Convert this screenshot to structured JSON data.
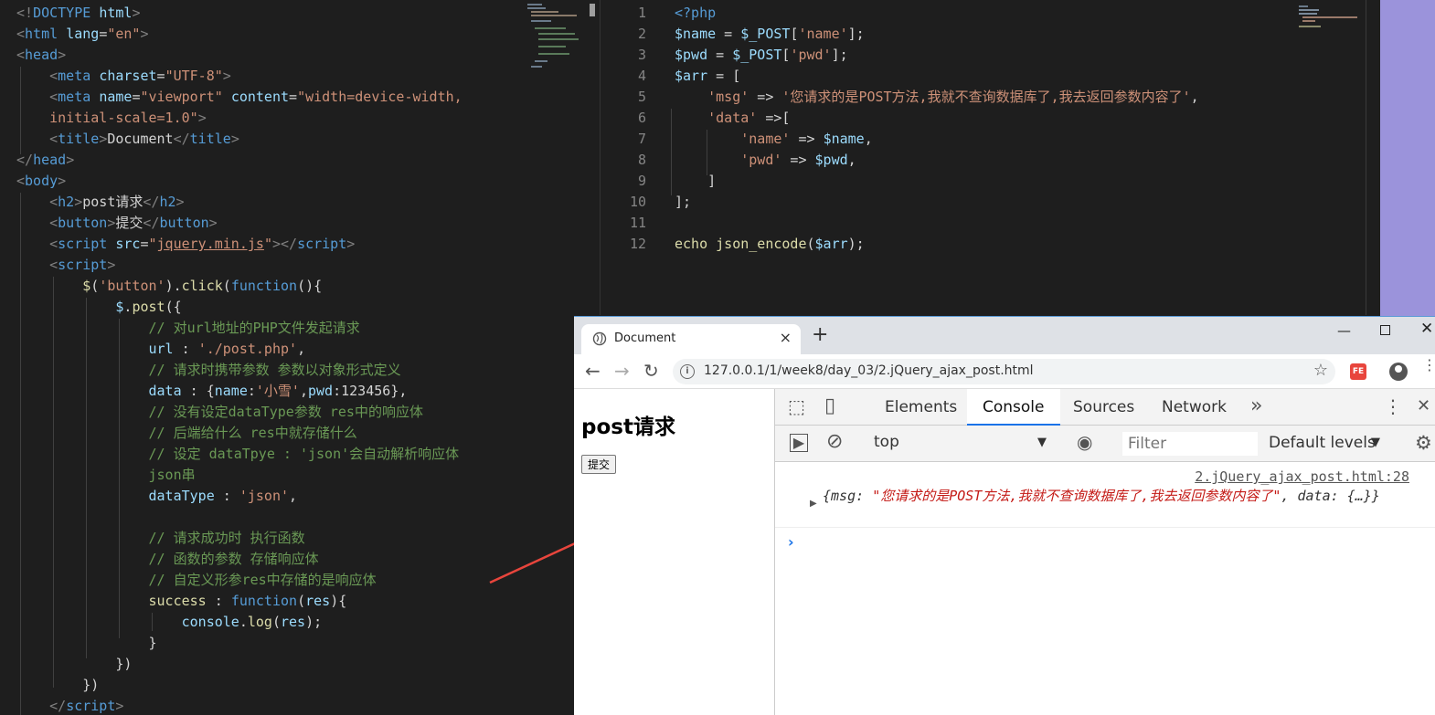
{
  "left_editor": {
    "lines": [
      [
        [
          "tg",
          "<!"
        ],
        [
          "tn",
          "DOCTYPE"
        ],
        [
          "pl",
          " "
        ],
        [
          "at",
          "html"
        ],
        [
          "tg",
          ">"
        ]
      ],
      [
        [
          "tg",
          "<"
        ],
        [
          "tn",
          "html"
        ],
        [
          "pl",
          " "
        ],
        [
          "at",
          "lang"
        ],
        [
          "pl",
          "="
        ],
        [
          "st",
          "\"en\""
        ],
        [
          "tg",
          ">"
        ]
      ],
      [
        [
          "tg",
          "<"
        ],
        [
          "tn",
          "head"
        ],
        [
          "tg",
          ">"
        ]
      ],
      [
        [
          "pl",
          "    "
        ],
        [
          "tg",
          "<"
        ],
        [
          "tn",
          "meta"
        ],
        [
          "pl",
          " "
        ],
        [
          "at",
          "charset"
        ],
        [
          "pl",
          "="
        ],
        [
          "st",
          "\"UTF-8\""
        ],
        [
          "tg",
          ">"
        ]
      ],
      [
        [
          "pl",
          "    "
        ],
        [
          "tg",
          "<"
        ],
        [
          "tn",
          "meta"
        ],
        [
          "pl",
          " "
        ],
        [
          "at",
          "name"
        ],
        [
          "pl",
          "="
        ],
        [
          "st",
          "\"viewport\""
        ],
        [
          "pl",
          " "
        ],
        [
          "at",
          "content"
        ],
        [
          "pl",
          "="
        ],
        [
          "st",
          "\"width=device-width,"
        ]
      ],
      [
        [
          "pl",
          "    "
        ],
        [
          "st",
          "initial-scale=1.0\""
        ],
        [
          "tg",
          ">"
        ]
      ],
      [
        [
          "pl",
          "    "
        ],
        [
          "tg",
          "<"
        ],
        [
          "tn",
          "title"
        ],
        [
          "tg",
          ">"
        ],
        [
          "pl",
          "Document"
        ],
        [
          "tg",
          "</"
        ],
        [
          "tn",
          "title"
        ],
        [
          "tg",
          ">"
        ]
      ],
      [
        [
          "tg",
          "</"
        ],
        [
          "tn",
          "head"
        ],
        [
          "tg",
          ">"
        ]
      ],
      [
        [
          "tg",
          "<"
        ],
        [
          "tn",
          "body"
        ],
        [
          "tg",
          ">"
        ]
      ],
      [
        [
          "pl",
          "    "
        ],
        [
          "tg",
          "<"
        ],
        [
          "tn",
          "h2"
        ],
        [
          "tg",
          ">"
        ],
        [
          "pl",
          "post请求"
        ],
        [
          "tg",
          "</"
        ],
        [
          "tn",
          "h2"
        ],
        [
          "tg",
          ">"
        ]
      ],
      [
        [
          "pl",
          "    "
        ],
        [
          "tg",
          "<"
        ],
        [
          "tn",
          "button"
        ],
        [
          "tg",
          ">"
        ],
        [
          "pl",
          "提交"
        ],
        [
          "tg",
          "</"
        ],
        [
          "tn",
          "button"
        ],
        [
          "tg",
          ">"
        ]
      ],
      [
        [
          "pl",
          "    "
        ],
        [
          "tg",
          "<"
        ],
        [
          "tn",
          "script"
        ],
        [
          "pl",
          " "
        ],
        [
          "at",
          "src"
        ],
        [
          "pl",
          "="
        ],
        [
          "st",
          "\""
        ],
        [
          "st ul",
          "jquery.min.js"
        ],
        [
          "st",
          "\""
        ],
        [
          "tg",
          "></"
        ],
        [
          "tn",
          "script"
        ],
        [
          "tg",
          ">"
        ]
      ],
      [
        [
          "pl",
          "    "
        ],
        [
          "tg",
          "<"
        ],
        [
          "tn",
          "script"
        ],
        [
          "tg",
          ">"
        ]
      ],
      [
        [
          "pl",
          "        "
        ],
        [
          "fn",
          "$"
        ],
        [
          "pl",
          "("
        ],
        [
          "st",
          "'button'"
        ],
        [
          "pl",
          ")."
        ],
        [
          "fn",
          "click"
        ],
        [
          "pl",
          "("
        ],
        [
          "kw",
          "function"
        ],
        [
          "pl",
          "(){"
        ]
      ],
      [
        [
          "pl",
          "            "
        ],
        [
          "vr",
          "$"
        ],
        [
          "pl",
          "."
        ],
        [
          "fn",
          "post"
        ],
        [
          "pl",
          "({"
        ]
      ],
      [
        [
          "pl",
          "                "
        ],
        [
          "cm",
          "// 对url地址的PHP文件发起请求"
        ]
      ],
      [
        [
          "pl",
          "                "
        ],
        [
          "vr",
          "url"
        ],
        [
          "pl",
          " : "
        ],
        [
          "st",
          "'./post.php'"
        ],
        [
          "pl",
          ","
        ]
      ],
      [
        [
          "pl",
          "                "
        ],
        [
          "cm",
          "// 请求时携带参数 参数以对象形式定义"
        ]
      ],
      [
        [
          "pl",
          "                "
        ],
        [
          "vr",
          "data"
        ],
        [
          "pl",
          " : {"
        ],
        [
          "vr",
          "name"
        ],
        [
          "pl",
          ":"
        ],
        [
          "st",
          "'小雪'"
        ],
        [
          "pl",
          ","
        ],
        [
          "vr",
          "pwd"
        ],
        [
          "pl",
          ":123456},"
        ]
      ],
      [
        [
          "pl",
          "                "
        ],
        [
          "cm",
          "// 没有设定dataType参数 res中的响应体"
        ]
      ],
      [
        [
          "pl",
          "                "
        ],
        [
          "cm",
          "// 后端给什么 res中就存储什么"
        ]
      ],
      [
        [
          "pl",
          "                "
        ],
        [
          "cm",
          "// 设定 dataTpye : 'json'会自动解析响应体"
        ]
      ],
      [
        [
          "pl",
          "                "
        ],
        [
          "cm",
          "json串"
        ]
      ],
      [
        [
          "pl",
          "                "
        ],
        [
          "vr",
          "dataType"
        ],
        [
          "pl",
          " : "
        ],
        [
          "st",
          "'json'"
        ],
        [
          "pl",
          ","
        ]
      ],
      [
        [
          "pl",
          ""
        ]
      ],
      [
        [
          "pl",
          "                "
        ],
        [
          "cm",
          "// 请求成功时 执行函数"
        ]
      ],
      [
        [
          "pl",
          "                "
        ],
        [
          "cm",
          "// 函数的参数 存储响应体"
        ]
      ],
      [
        [
          "pl",
          "                "
        ],
        [
          "cm",
          "// 自定义形参res中存储的是响应体"
        ]
      ],
      [
        [
          "pl",
          "                "
        ],
        [
          "fn",
          "success"
        ],
        [
          "pl",
          " : "
        ],
        [
          "kw",
          "function"
        ],
        [
          "pl",
          "("
        ],
        [
          "vr",
          "res"
        ],
        [
          "pl",
          "){"
        ]
      ],
      [
        [
          "pl",
          "                    "
        ],
        [
          "vr",
          "console"
        ],
        [
          "pl",
          "."
        ],
        [
          "fn",
          "log"
        ],
        [
          "pl",
          "("
        ],
        [
          "vr",
          "res"
        ],
        [
          "pl",
          ");"
        ]
      ],
      [
        [
          "pl",
          "                }"
        ]
      ],
      [
        [
          "pl",
          "            })"
        ]
      ],
      [
        [
          "pl",
          "        })"
        ]
      ],
      [
        [
          "pl",
          "    "
        ],
        [
          "tg",
          "</"
        ],
        [
          "tn",
          "script"
        ],
        [
          "tg",
          ">"
        ]
      ]
    ]
  },
  "right_editor": {
    "line_numbers": [
      "1",
      "2",
      "3",
      "4",
      "5",
      "6",
      "7",
      "8",
      "9",
      "10",
      "11",
      "12"
    ],
    "lines": [
      [
        [
          "kw",
          "<?php"
        ]
      ],
      [
        [
          "vr",
          "$name"
        ],
        [
          "pl",
          " = "
        ],
        [
          "vr",
          "$_POST"
        ],
        [
          "pl",
          "["
        ],
        [
          "st",
          "'name'"
        ],
        [
          "pl",
          "];"
        ]
      ],
      [
        [
          "vr",
          "$pwd"
        ],
        [
          "pl",
          " = "
        ],
        [
          "vr",
          "$_POST"
        ],
        [
          "pl",
          "["
        ],
        [
          "st",
          "'pwd'"
        ],
        [
          "pl",
          "];"
        ]
      ],
      [
        [
          "vr",
          "$arr"
        ],
        [
          "pl",
          " = ["
        ]
      ],
      [
        [
          "pl",
          "    "
        ],
        [
          "st",
          "'msg'"
        ],
        [
          "pl",
          " => "
        ],
        [
          "st",
          "'您请求的是POST方法,我就不查询数据库了,我去返回参数内容了'"
        ],
        [
          "pl",
          ","
        ]
      ],
      [
        [
          "pl",
          "    "
        ],
        [
          "st",
          "'data'"
        ],
        [
          "pl",
          " =>["
        ]
      ],
      [
        [
          "pl",
          "        "
        ],
        [
          "st",
          "'name'"
        ],
        [
          "pl",
          " => "
        ],
        [
          "vr",
          "$name"
        ],
        [
          "pl",
          ","
        ]
      ],
      [
        [
          "pl",
          "        "
        ],
        [
          "st",
          "'pwd'"
        ],
        [
          "pl",
          " => "
        ],
        [
          "vr",
          "$pwd"
        ],
        [
          "pl",
          ","
        ]
      ],
      [
        [
          "pl",
          "    ]"
        ]
      ],
      [
        [
          "pl",
          "];"
        ]
      ],
      [
        [
          "pl",
          ""
        ]
      ],
      [
        [
          "fn",
          "echo"
        ],
        [
          "pl",
          " "
        ],
        [
          "fn",
          "json_encode"
        ],
        [
          "pl",
          "("
        ],
        [
          "vr",
          "$arr"
        ],
        [
          "pl",
          ");"
        ]
      ]
    ]
  },
  "browser": {
    "tab_title": "Document",
    "tab_close": "×",
    "new_tab": "+",
    "window_min": "—",
    "window_close": "✕",
    "nav_back": "←",
    "nav_forward": "→",
    "nav_reload": "↻",
    "lock_glyph": "i",
    "url": "127.0.0.1/1/week8/day_03/2.jQuery_ajax_post.html",
    "star": "☆",
    "ext_label": "FE",
    "menu": "⋮"
  },
  "page": {
    "heading": "post请求",
    "button": "提交"
  },
  "devtools": {
    "inspect_icon": "⬚",
    "device_icon": "▯",
    "tabs": [
      "Elements",
      "Console",
      "Sources",
      "Network"
    ],
    "more_tabs": "»",
    "kebab": "⋮",
    "close": "✕",
    "sidebar_icon": "▶",
    "clear_icon": "⊘",
    "context": "top",
    "context_arrow": "▼",
    "eye_icon": "◉",
    "filter_placeholder": "Filter",
    "levels": "Default levels",
    "levels_arrow": "▼",
    "settings_icon": "⚙",
    "source_link": "2.jQuery_ajax_post.html:28",
    "expand_arrow": "▶",
    "object_prefix": "{msg: ",
    "object_msg": "\"您请求的是POST方法,我就不查询数据库了,我去返回参数内容了\"",
    "object_suffix": ", data: {…}}",
    "prompt": "›"
  },
  "colors": {
    "editor_bg": "#1e1e1e",
    "accent": "#1a73e8",
    "annotation_arrow": "#e8453c",
    "desktop_purple": "#9b93db"
  }
}
